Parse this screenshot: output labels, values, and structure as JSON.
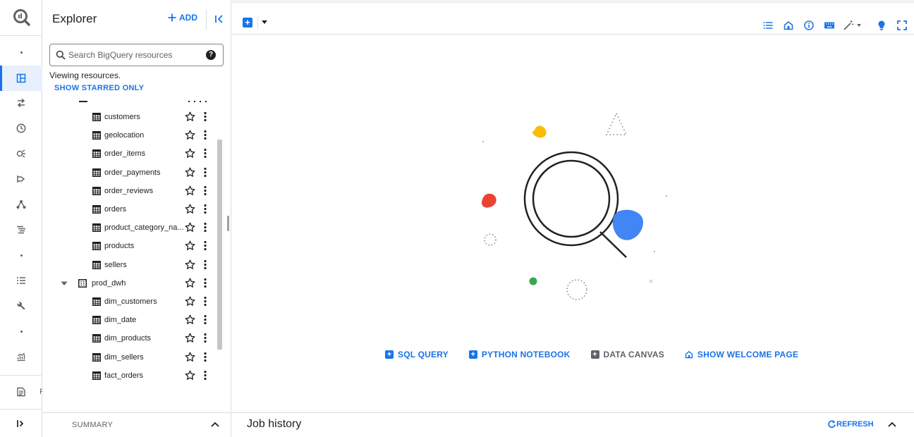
{
  "explorer": {
    "title": "Explorer",
    "add_label": "ADD",
    "search_placeholder": "Search BigQuery resources",
    "viewing_text": "Viewing resources.",
    "show_starred_label": "SHOW STARRED ONLY",
    "tables_group1": [
      "customers",
      "geolocation",
      "order_items",
      "order_payments",
      "order_reviews",
      "orders",
      "product_category_na...",
      "products",
      "sellers"
    ],
    "dataset": {
      "name": "prod_dwh",
      "expanded": true
    },
    "tables_group2": [
      "dim_customers",
      "dim_date",
      "dim_products",
      "dim_sellers",
      "fact_orders"
    ],
    "summary_label": "SUMMARY"
  },
  "actions": {
    "sql_query": "SQL QUERY",
    "python_notebook": "PYTHON NOTEBOOK",
    "data_canvas": "DATA CANVAS",
    "show_welcome": "SHOW WELCOME PAGE"
  },
  "job_history": {
    "title": "Job history",
    "refresh_label": "REFRESH"
  },
  "colors": {
    "accent": "#1a73e8",
    "disabled": "#5f6368",
    "illus_yellow": "#fbbc04",
    "illus_red": "#ea4335",
    "illus_blue": "#4285f4",
    "illus_green": "#34a853"
  }
}
